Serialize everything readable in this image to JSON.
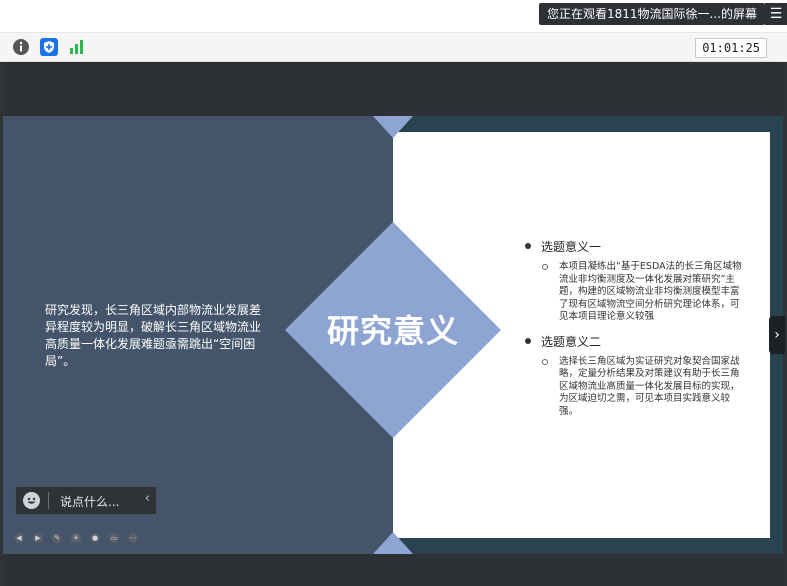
{
  "share_banner": {
    "text": "您正在观看1811物流国际徐一...的屏幕",
    "menu_icon": "list-icon"
  },
  "toolbar": {
    "icons": [
      "info-icon",
      "shield-icon",
      "signal-icon"
    ],
    "timer": "01:01:25"
  },
  "slide": {
    "title": "研究意义",
    "left_text": "研究发现，长三角区域内部物流业发展差异程度较为明显，破解长三角区域物流业高质量一体化发展难题亟需跳出“空间困局”。",
    "points": [
      {
        "heading": "选题意义一",
        "detail": "本项目凝练出“基于ESDA法的长三角区域物流业非均衡测度及一体化发展对策研究”主题，构建的区域物流业非均衡测度模型丰富了现有区域物流空间分析研究理论体系，可见本项目理论意义较强"
      },
      {
        "heading": "选题意义二",
        "detail": "选择长三角区域为实证研究对象契合国家战略，定量分析结果及对策建议有助于长三角区域物流业高质量一体化发展目标的实现，为区域迫切之需，可见本项目实践意义较强。"
      }
    ],
    "colors": {
      "left_panel": "#44546a",
      "accent": "#8ea5d4",
      "background": "#2a4350"
    }
  },
  "chat": {
    "placeholder": "说点什么...",
    "emoji_icon": "smile-icon",
    "collapse_icon": "chevron-left-icon"
  },
  "slide_controls": [
    "prev-icon",
    "next-icon",
    "pen-icon",
    "laser-icon",
    "camera-icon",
    "screen-icon",
    "more-icon"
  ],
  "side_handle": {
    "icon": "chevron-right-icon"
  }
}
